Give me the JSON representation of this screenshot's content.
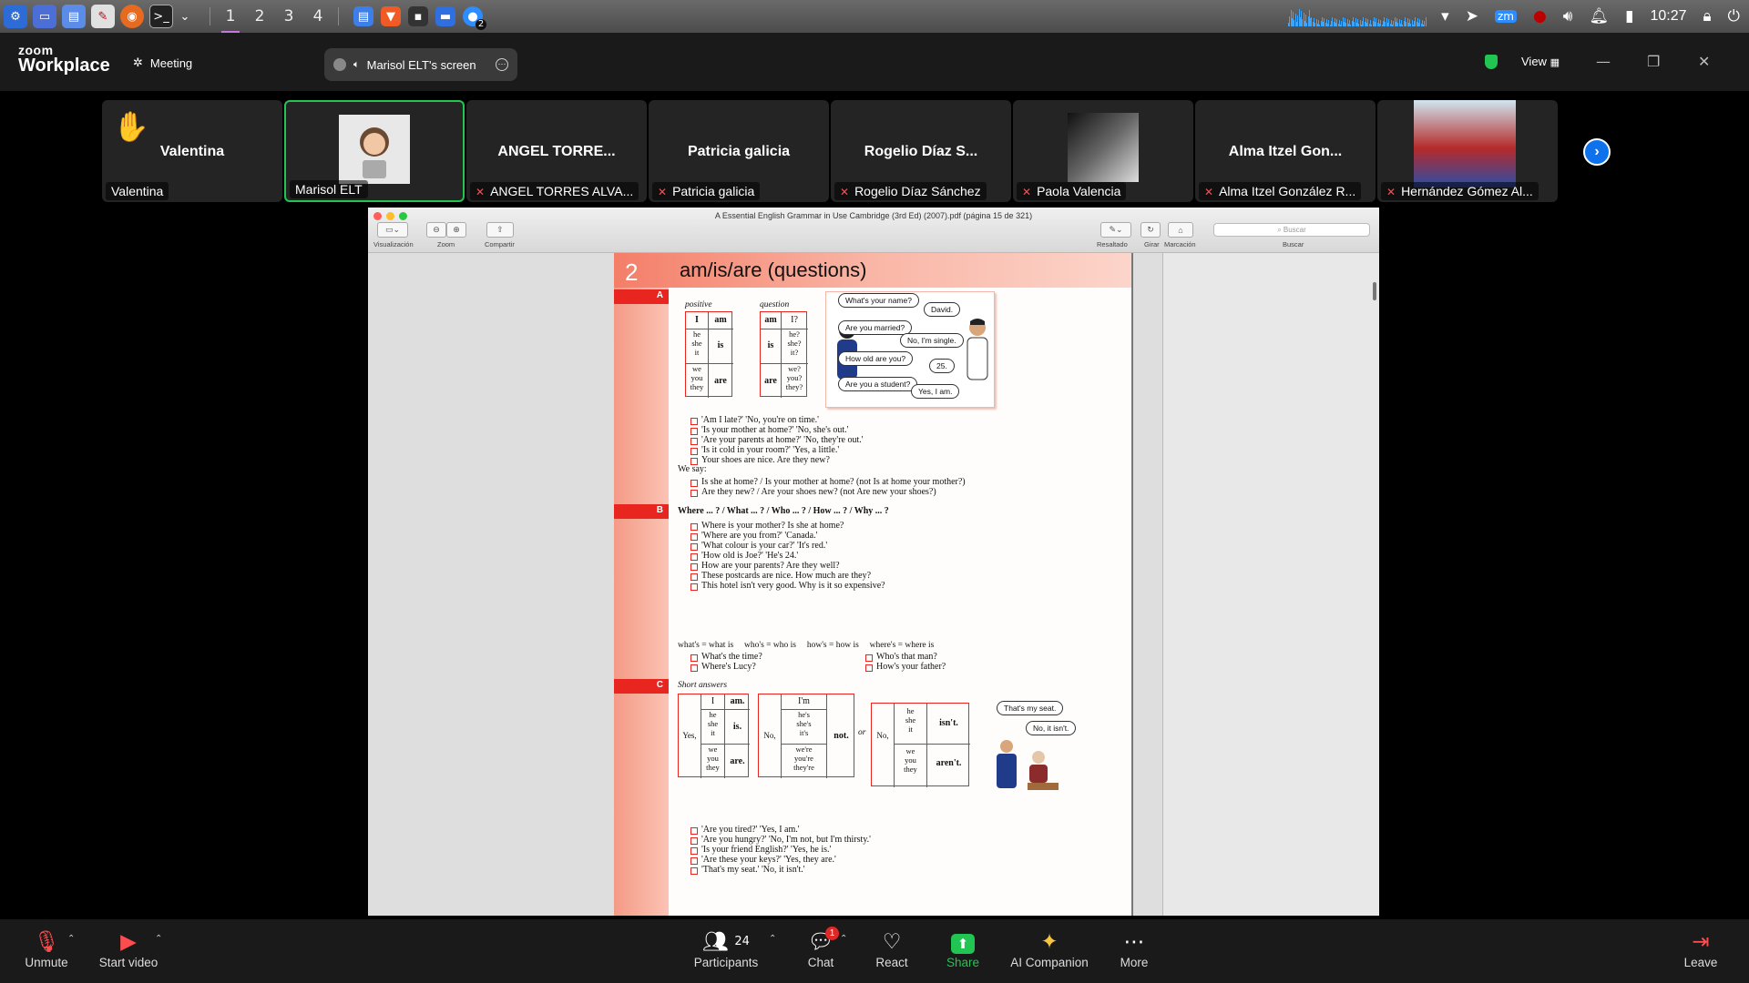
{
  "os": {
    "workspaces": [
      "1",
      "2",
      "3",
      "4"
    ],
    "time": "10:27",
    "zm_label": "zm",
    "task_badge": "2"
  },
  "zoom": {
    "brand_top": "zoom",
    "brand_bottom": "Workplace",
    "meeting_label": "Meeting",
    "screen_share_label": "Marisol ELT's screen",
    "view_label": "View"
  },
  "participants": [
    {
      "big": "Valentina",
      "label": "Valentina",
      "muted": false,
      "hand": true
    },
    {
      "big": "",
      "label": "Marisol ELT",
      "muted": false,
      "active": true
    },
    {
      "big": "ANGEL TORRE...",
      "label": "ANGEL TORRES ALVA...",
      "muted": true
    },
    {
      "big": "Patricia galicia",
      "label": "Patricia galicia",
      "muted": true
    },
    {
      "big": "Rogelio Díaz S...",
      "label": "Rogelio Díaz Sánchez",
      "muted": true
    },
    {
      "big": "",
      "label": "Paola Valencia",
      "muted": true
    },
    {
      "big": "Alma Itzel Gon...",
      "label": "Alma Itzel González R...",
      "muted": true
    },
    {
      "big": "",
      "label": "Hernández Gómez Al...",
      "muted": true
    }
  ],
  "preview": {
    "window_title": "A Essential English Grammar in Use Cambridge (3rd Ed) (2007).pdf (página 15 de 321)",
    "tools": [
      "Visualización",
      "Zoom",
      "Compartir"
    ],
    "right_tools": [
      "Resaltado",
      "Girar",
      "Marcación",
      "Buscar"
    ],
    "search_placeholder": "Buscar"
  },
  "page": {
    "unit_word": "Unit",
    "unit_number": "2",
    "title": "am/is/are (questions)",
    "sections": [
      "A",
      "B",
      "C"
    ],
    "a": {
      "positive_label": "positive",
      "question_label": "question",
      "pos_rows": [
        [
          "I",
          "am"
        ],
        [
          "he\nshe\nit",
          "is"
        ],
        [
          "we\nyou\nthey",
          "are"
        ]
      ],
      "q_rows": [
        [
          "am",
          "I?"
        ],
        [
          "is",
          "he?\nshe?\nit?"
        ],
        [
          "are",
          "we?\nyou?\nthey?"
        ]
      ],
      "bubbles_left": [
        "What's your name?",
        "Are you married?",
        "How old are you?",
        "Are you a student?"
      ],
      "bubbles_right": [
        "David.",
        "No, I'm single.",
        "25.",
        "Yes, I am."
      ],
      "examples": [
        "'Am I late?'   'No, you're on time.'",
        "'Is your mother at home?'   'No, she's out.'",
        "'Are your parents at home?'   'No, they're out.'",
        "'Is it cold in your room?'   'Yes, a little.'",
        "Your shoes are nice.  Are they new?"
      ],
      "we_say": "We say:",
      "we_say_items": [
        "Is she at home? / Is your mother at home?  (not Is at home your mother?)",
        "Are they new? / Are your shoes new?  (not Are new your shoes?)"
      ]
    },
    "b": {
      "heading": "Where ... ? / What ... ? / Who ... ? / How ... ? / Why ... ?",
      "items": [
        "Where is your mother?  Is she at home?",
        "'Where are you from?'   'Canada.'",
        "'What colour is your car?'   'It's red.'",
        "'How old is Joe?'   'He's 24.'",
        "How are your parents?  Are they well?",
        "These postcards are nice.  How much are they?",
        "This hotel isn't very good.  Why is it so expensive?"
      ],
      "contractions": "what's = what is     who's = who is     how's = how is     where's = where is",
      "left_col": [
        "What's the time?",
        "Where's Lucy?"
      ],
      "right_col": [
        "Who's that man?",
        "How's your father?"
      ]
    },
    "c": {
      "heading": "Short answers",
      "yes": "Yes,",
      "no": "No,",
      "or": "or",
      "not": "not.",
      "yes_pron": [
        "I",
        "he\nshe\nit",
        "we\nyou\nthey"
      ],
      "yes_verb": [
        "am.",
        "is.",
        "are."
      ],
      "no_pron": [
        "I'm",
        "he's\nshe's\nit's",
        "we're\nyou're\nthey're"
      ],
      "no2_pron": [
        "he\nshe\nit",
        "we\nyou\nthey"
      ],
      "no2_verb": [
        "isn't.",
        "aren't."
      ],
      "bubbles": [
        "That's my seat.",
        "No, it isn't."
      ],
      "items": [
        "'Are you tired?'   'Yes, I am.'",
        "'Are you hungry?'   'No, I'm not, but I'm thirsty.'",
        "'Is your friend English?'   'Yes, he is.'",
        "'Are these your keys?'   'Yes, they are.'",
        "'That's my seat.'   'No, it isn't.'"
      ]
    }
  },
  "toolbar": {
    "unmute": "Unmute",
    "start_video": "Start video",
    "participants": "Participants",
    "participants_count": "24",
    "chat": "Chat",
    "chat_badge": "1",
    "react": "React",
    "share": "Share",
    "ai_companion": "AI Companion",
    "more": "More",
    "leave": "Leave"
  },
  "colors": {
    "zoom_green": "#23c552",
    "zoom_blue": "#0e72ed",
    "muted_red": "#ff4d4f",
    "grammar_red": "#e8251f"
  }
}
